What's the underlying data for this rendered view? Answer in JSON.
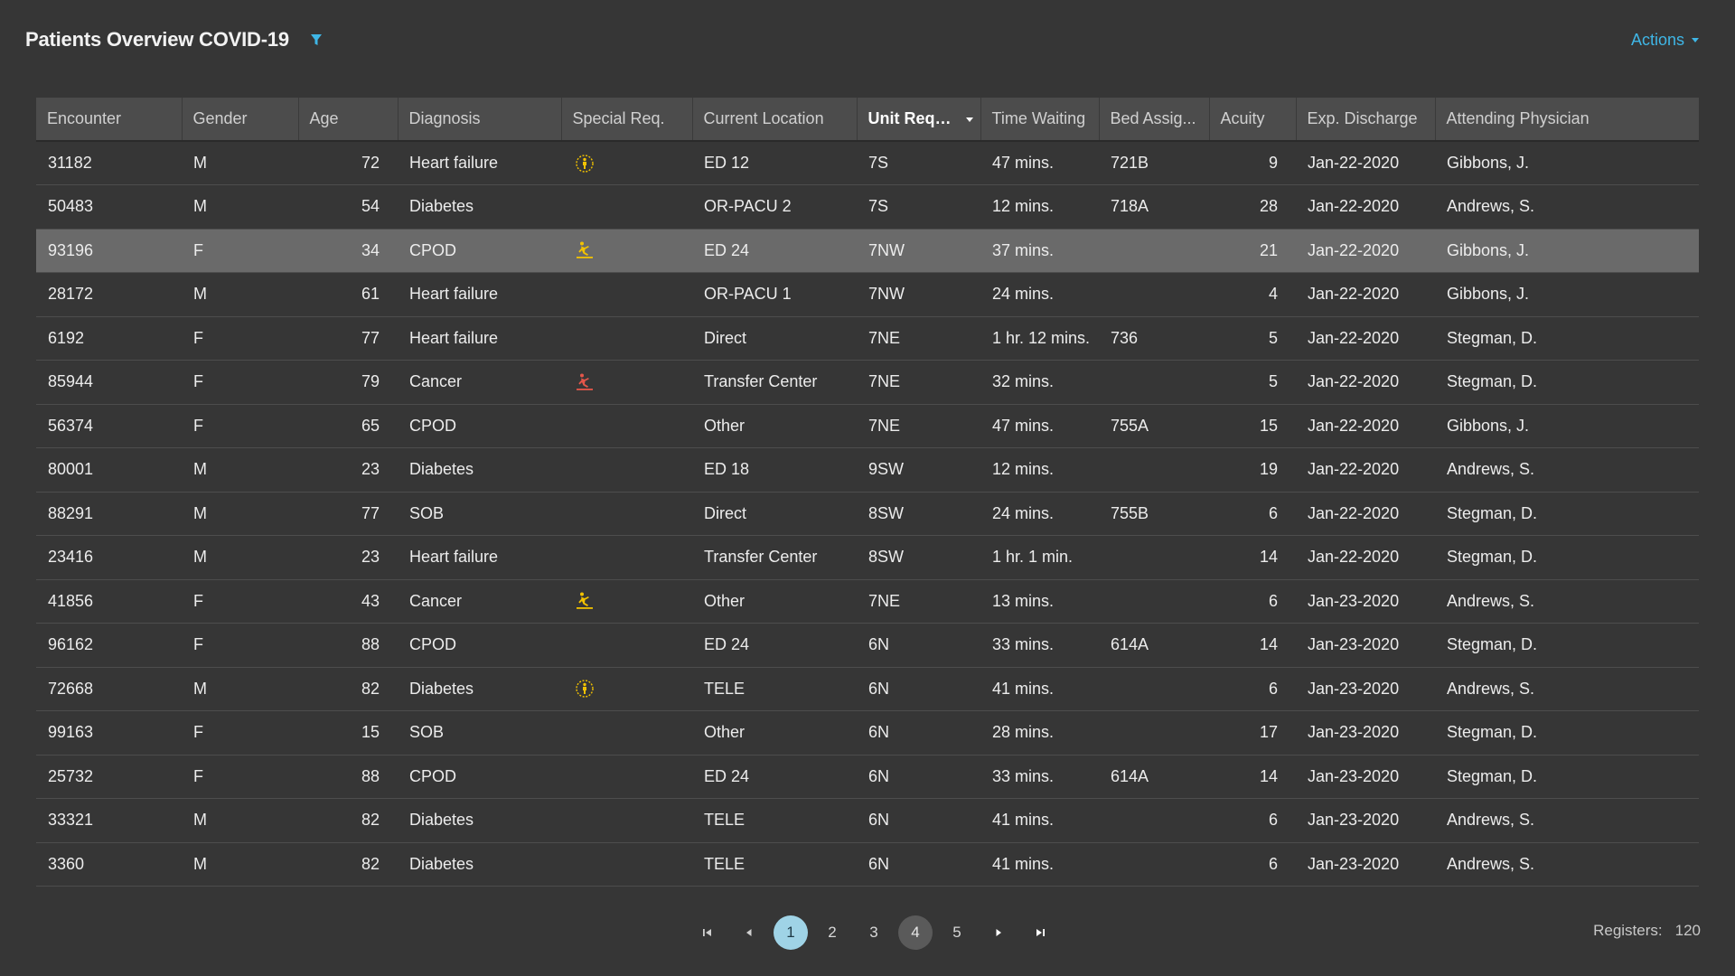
{
  "header": {
    "title": "Patients Overview COVID-19",
    "actions_label": "Actions"
  },
  "colors": {
    "accent": "#3fb6e6",
    "icon_yellow": "#f2c200",
    "icon_red": "#e4564a",
    "selected_row": "#6a6a6a"
  },
  "table": {
    "columns": [
      "Encounter",
      "Gender",
      "Age",
      "Diagnosis",
      "Special Req.",
      "Current Location",
      "Unit Requ...",
      "Time Waiting",
      "Bed Assig...",
      "Acuity",
      "Exp. Discharge",
      "Attending Physician"
    ],
    "sorted_column": "Unit Requ...",
    "rows": [
      {
        "encounter": "31182",
        "gender": "M",
        "age": "72",
        "diagnosis": "Heart failure",
        "special_req": "person-sun-icon",
        "location": "ED 12",
        "unit": "7S",
        "waiting": "47 mins.",
        "bed": "721B",
        "acuity": "9",
        "discharge": "Jan-22-2020",
        "physician": "Gibbons, J."
      },
      {
        "encounter": "50483",
        "gender": "M",
        "age": "54",
        "diagnosis": "Diabetes",
        "special_req": "",
        "location": "OR-PACU 2",
        "unit": "7S",
        "waiting": "12 mins.",
        "bed": "718A",
        "acuity": "28",
        "discharge": "Jan-22-2020",
        "physician": "Andrews, S."
      },
      {
        "encounter": "93196",
        "gender": "F",
        "age": "34",
        "diagnosis": "CPOD",
        "special_req": "fall-risk-icon",
        "location": "ED 24",
        "unit": "7NW",
        "waiting": "37 mins.",
        "bed": "",
        "acuity": "21",
        "discharge": "Jan-22-2020",
        "physician": "Gibbons, J."
      },
      {
        "encounter": "28172",
        "gender": "M",
        "age": "61",
        "diagnosis": "Heart failure",
        "special_req": "",
        "location": "OR-PACU 1",
        "unit": "7NW",
        "waiting": "24 mins.",
        "bed": "",
        "acuity": "4",
        "discharge": "Jan-22-2020",
        "physician": "Gibbons, J."
      },
      {
        "encounter": "6192",
        "gender": "F",
        "age": "77",
        "diagnosis": "Heart failure",
        "special_req": "",
        "location": "Direct",
        "unit": "7NE",
        "waiting": "1 hr. 12 mins.",
        "bed": "736",
        "acuity": "5",
        "discharge": "Jan-22-2020",
        "physician": "Stegman, D."
      },
      {
        "encounter": "85944",
        "gender": "F",
        "age": "79",
        "diagnosis": "Cancer",
        "special_req": "fall-risk-red-icon",
        "location": "Transfer Center",
        "unit": "7NE",
        "waiting": "32 mins.",
        "bed": "",
        "acuity": "5",
        "discharge": "Jan-22-2020",
        "physician": "Stegman, D."
      },
      {
        "encounter": "56374",
        "gender": "F",
        "age": "65",
        "diagnosis": "CPOD",
        "special_req": "",
        "location": "Other",
        "unit": "7NE",
        "waiting": "47 mins.",
        "bed": "755A",
        "acuity": "15",
        "discharge": "Jan-22-2020",
        "physician": "Gibbons, J."
      },
      {
        "encounter": "80001",
        "gender": "M",
        "age": "23",
        "diagnosis": "Diabetes",
        "special_req": "",
        "location": "ED 18",
        "unit": "9SW",
        "waiting": "12 mins.",
        "bed": "",
        "acuity": "19",
        "discharge": "Jan-22-2020",
        "physician": "Andrews, S."
      },
      {
        "encounter": "88291",
        "gender": "M",
        "age": "77",
        "diagnosis": "SOB",
        "special_req": "",
        "location": "Direct",
        "unit": "8SW",
        "waiting": "24 mins.",
        "bed": "755B",
        "acuity": "6",
        "discharge": "Jan-22-2020",
        "physician": "Stegman, D."
      },
      {
        "encounter": "23416",
        "gender": "M",
        "age": "23",
        "diagnosis": "Heart failure",
        "special_req": "",
        "location": "Transfer Center",
        "unit": "8SW",
        "waiting": "1 hr. 1 min.",
        "bed": "",
        "acuity": "14",
        "discharge": "Jan-22-2020",
        "physician": "Stegman, D."
      },
      {
        "encounter": "41856",
        "gender": "F",
        "age": "43",
        "diagnosis": "Cancer",
        "special_req": "fall-risk-icon",
        "location": "Other",
        "unit": "7NE",
        "waiting": "13 mins.",
        "bed": "",
        "acuity": "6",
        "discharge": "Jan-23-2020",
        "physician": "Andrews, S."
      },
      {
        "encounter": "96162",
        "gender": "F",
        "age": "88",
        "diagnosis": "CPOD",
        "special_req": "",
        "location": "ED 24",
        "unit": "6N",
        "waiting": "33 mins.",
        "bed": "614A",
        "acuity": "14",
        "discharge": "Jan-23-2020",
        "physician": "Stegman, D."
      },
      {
        "encounter": "72668",
        "gender": "M",
        "age": "82",
        "diagnosis": "Diabetes",
        "special_req": "person-sun-icon",
        "location": "TELE",
        "unit": "6N",
        "waiting": "41 mins.",
        "bed": "",
        "acuity": "6",
        "discharge": "Jan-23-2020",
        "physician": "Andrews, S."
      },
      {
        "encounter": "99163",
        "gender": "F",
        "age": "15",
        "diagnosis": "SOB",
        "special_req": "",
        "location": "Other",
        "unit": "6N",
        "waiting": "28 mins.",
        "bed": "",
        "acuity": "17",
        "discharge": "Jan-23-2020",
        "physician": "Stegman, D."
      },
      {
        "encounter": "25732",
        "gender": "F",
        "age": "88",
        "diagnosis": "CPOD",
        "special_req": "",
        "location": "ED 24",
        "unit": "6N",
        "waiting": "33 mins.",
        "bed": "614A",
        "acuity": "14",
        "discharge": "Jan-23-2020",
        "physician": "Stegman, D."
      },
      {
        "encounter": "33321",
        "gender": "M",
        "age": "82",
        "diagnosis": "Diabetes",
        "special_req": "",
        "location": "TELE",
        "unit": "6N",
        "waiting": "41 mins.",
        "bed": "",
        "acuity": "6",
        "discharge": "Jan-23-2020",
        "physician": "Andrews, S."
      },
      {
        "encounter": "3360",
        "gender": "M",
        "age": "82",
        "diagnosis": "Diabetes",
        "special_req": "",
        "location": "TELE",
        "unit": "6N",
        "waiting": "41 mins.",
        "bed": "",
        "acuity": "6",
        "discharge": "Jan-23-2020",
        "physician": "Andrews, S."
      }
    ],
    "selected_row_index": 2
  },
  "pagination": {
    "pages": [
      "1",
      "2",
      "3",
      "4",
      "5"
    ],
    "current_page": "1",
    "hovered_page": "4",
    "registers_label": "Registers:",
    "registers_count": "120"
  }
}
